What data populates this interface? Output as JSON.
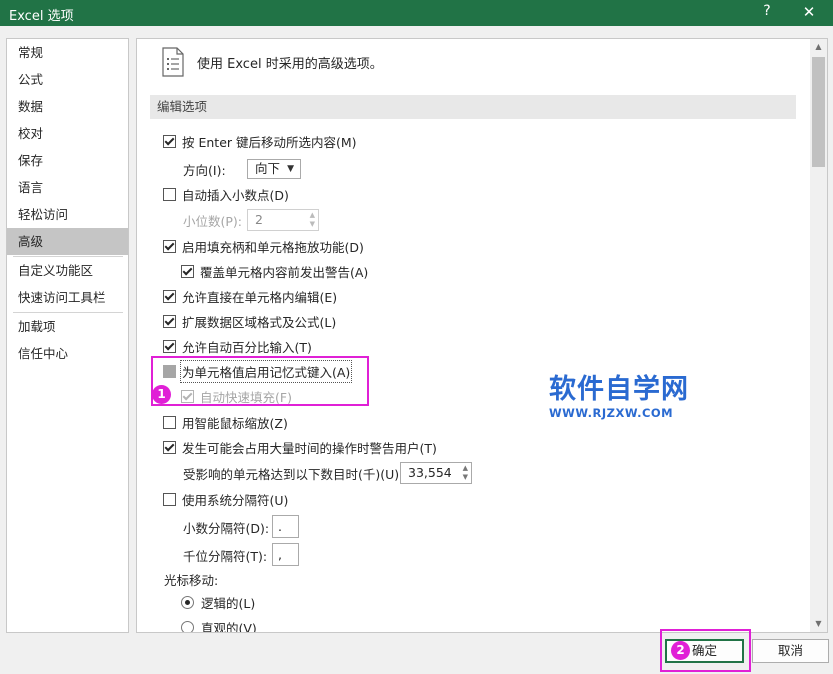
{
  "window": {
    "title": "Excel 选项",
    "help_label": "?",
    "close_label": "✕"
  },
  "sidebar": {
    "items": [
      {
        "label": "常规"
      },
      {
        "label": "公式"
      },
      {
        "label": "数据"
      },
      {
        "label": "校对"
      },
      {
        "label": "保存"
      },
      {
        "label": "语言"
      },
      {
        "label": "轻松访问"
      },
      {
        "label": "高级"
      },
      {
        "label": "自定义功能区"
      },
      {
        "label": "快速访问工具栏"
      },
      {
        "label": "加载项"
      },
      {
        "label": "信任中心"
      }
    ],
    "selected": "高级"
  },
  "main": {
    "header_text": "使用 Excel 时采用的高级选项。",
    "section_title": "编辑选项",
    "options": {
      "move_after_enter": {
        "label": "按 Enter 键后移动所选内容(M)",
        "checked": true
      },
      "direction": {
        "label": "方向(I):",
        "value": "向下"
      },
      "auto_decimal": {
        "label": "自动插入小数点(D)",
        "checked": false
      },
      "decimal_places": {
        "label": "小位数(P):",
        "value": "2"
      },
      "fill_handle": {
        "label": "启用填充柄和单元格拖放功能(D)",
        "checked": true
      },
      "alert_overwrite": {
        "label": "覆盖单元格内容前发出警告(A)",
        "checked": true
      },
      "edit_in_cell": {
        "label": "允许直接在单元格内编辑(E)",
        "checked": true
      },
      "extend_formats": {
        "label": "扩展数据区域格式及公式(L)",
        "checked": true
      },
      "auto_percent": {
        "label": "允许自动百分比输入(T)",
        "checked": true
      },
      "autocomplete": {
        "label": "为单元格值启用记忆式键入(A)",
        "checked": false
      },
      "flash_fill": {
        "label": "自动快速填充(F)",
        "checked": true,
        "disabled": true
      },
      "intellimouse_zoom": {
        "label": "用智能鼠标缩放(Z)",
        "checked": false
      },
      "alert_slow_ops": {
        "label": "发生可能会占用大量时间的操作时警告用户(T)",
        "checked": true
      },
      "cells_affected": {
        "label": "受影响的单元格达到以下数目时(千)(U):",
        "value": "33,554"
      },
      "system_separators": {
        "label": "使用系统分隔符(U)",
        "checked": false
      },
      "decimal_separator": {
        "label": "小数分隔符(D):",
        "value": "."
      },
      "thousands_separator": {
        "label": "千位分隔符(T):",
        "value": ","
      },
      "cursor_movement": {
        "label": "光标移动:"
      },
      "logical": {
        "label": "逻辑的(L)",
        "selected": true
      },
      "visual": {
        "label": "直观的(V)",
        "selected": false
      }
    }
  },
  "annotations": {
    "step1": "1",
    "step2": "2"
  },
  "watermark": {
    "title": "软件自学网",
    "url": "WWW.RJZXW.COM"
  },
  "buttons": {
    "ok": "确定",
    "cancel": "取消"
  },
  "colors": {
    "title_bar": "#217346",
    "highlight": "#e020d6",
    "watermark": "#2a6ad1"
  }
}
